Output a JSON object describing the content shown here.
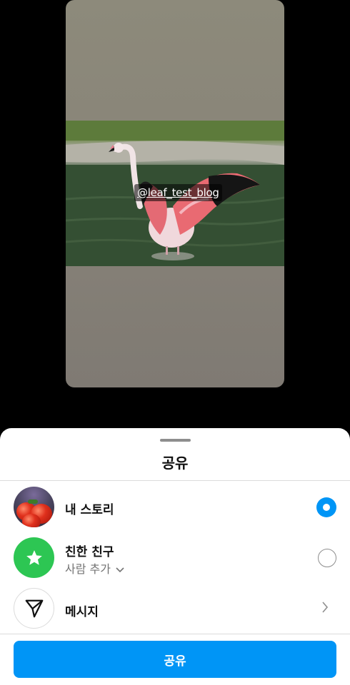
{
  "story_preview": {
    "mention_tag": "@leaf_test_blog"
  },
  "share_sheet": {
    "title": "공유",
    "options": [
      {
        "label": "내 스토리",
        "selected": true
      },
      {
        "label": "친한 친구",
        "sublabel": "사람 추가",
        "selected": false
      },
      {
        "label": "메시지"
      }
    ],
    "share_button_label": "공유"
  },
  "colors": {
    "accent": "#0095f6",
    "close_friends_green": "#2dc653"
  }
}
